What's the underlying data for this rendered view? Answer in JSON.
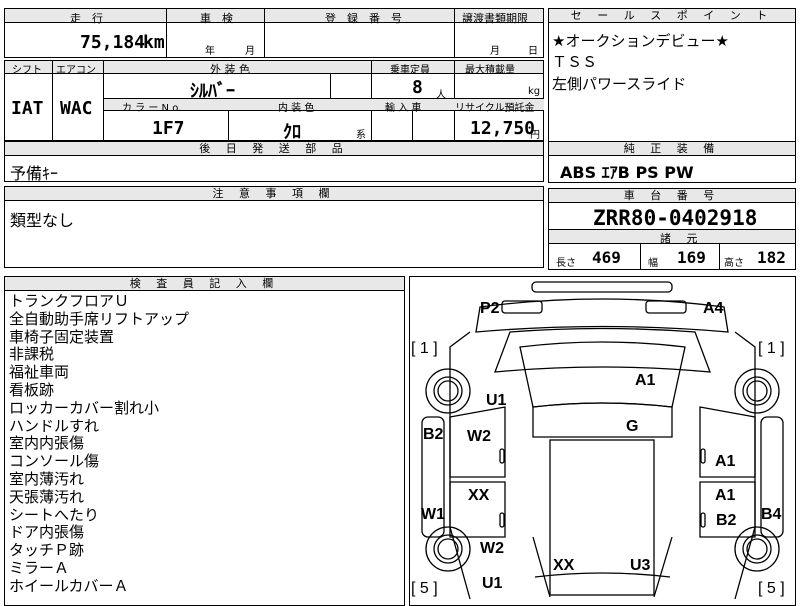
{
  "top": {
    "header_mileage": "走　行",
    "header_inspection": "車　検",
    "header_registration": "登　録　番　号",
    "header_transfer": "譲渡書類期限",
    "mileage_value": "75,184",
    "mileage_unit": "km",
    "inspection_year": "年",
    "inspection_month": "月",
    "transfer_month": "月",
    "transfer_day": "日"
  },
  "spec": {
    "header_shift": "シフト",
    "header_aircon": "エアコン",
    "header_exterior": "外 装 色",
    "header_capacity": "乗車定員",
    "header_load": "最大積載量",
    "shift": "IAT",
    "aircon": "WAC",
    "exterior_color": "ｼﾙﾊﾞｰ",
    "capacity": "8",
    "capacity_unit": "人",
    "load_unit": "kg",
    "header_color_no": "カ ラ ー N o.",
    "header_interior": "内 装 色",
    "header_import": "輸 入 車",
    "header_recycle": "リサイクル預託金",
    "color_no": "1F7",
    "interior": "ｸﾛ",
    "interior_suffix": "系",
    "recycle_value": "12,750",
    "recycle_unit": "円"
  },
  "later_parts": {
    "header": "後 日 発 送 部 品",
    "value": "予備ｷｰ"
  },
  "notes": {
    "header": "注 意 事 項 欄",
    "value": "類型なし"
  },
  "sales_points": {
    "header": "セ ー ル ス ポ イ ン ト",
    "items": [
      "★オークションデビュー★",
      "ＴＳＳ",
      "左側パワースライド"
    ]
  },
  "equipment": {
    "header": "純 正 装 備",
    "value": "ABS ｴｱB PS PW"
  },
  "chassis": {
    "header": "車 台 番 号",
    "value": "ZRR80-0402918"
  },
  "dimensions": {
    "header": "諸 元",
    "length_label": "長さ",
    "length": "469",
    "width_label": "幅",
    "width": "169",
    "height_label": "高さ",
    "height": "182"
  },
  "inspector": {
    "header": "検 査 員 記 入 欄",
    "items": [
      "トランクフロアＵ",
      "全自動助手席リフトアップ",
      "車椅子固定装置",
      "非課税",
      "福祉車両",
      "看板跡",
      "ロッカーカバー割れ小",
      "ハンドルすれ",
      "室内内張傷",
      "コンソール傷",
      "室内薄汚れ",
      "天張薄汚れ",
      "シートへたり",
      "ドア内張傷",
      "タッチＰ跡",
      "ミラーＡ",
      "ホイールカバーＡ"
    ]
  },
  "diagram": {
    "marks": [
      "P2",
      "A4",
      "[ 1 ]",
      "[ 1 ]",
      "A1",
      "U1",
      "B2",
      "W2",
      "G",
      "A1",
      "XX",
      "A1",
      "W1",
      "B2",
      "B4",
      "W2",
      "XX",
      "U3",
      "U1",
      "[ 5 ]",
      "[ 5 ]"
    ]
  }
}
